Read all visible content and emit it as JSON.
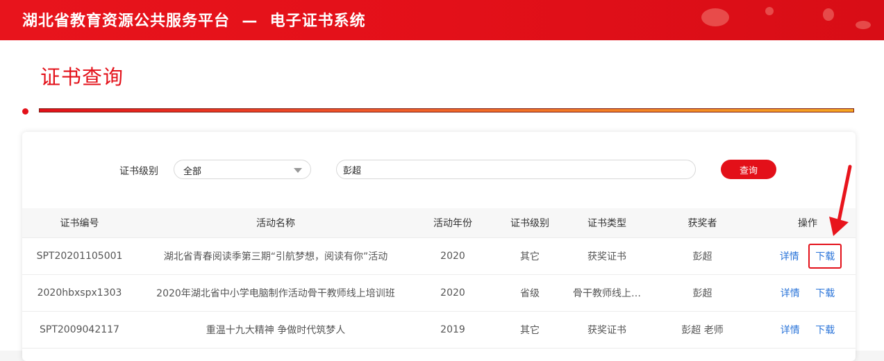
{
  "header": {
    "title": "湖北省教育资源公共服务平台  —  电子证书系统"
  },
  "page": {
    "title": "证书查询"
  },
  "filter": {
    "level_label": "证书级别",
    "level_selected": "全部",
    "search_value": "彭超",
    "search_button": "查询"
  },
  "table": {
    "headers": [
      "证书编号",
      "活动名称",
      "活动年份",
      "证书级别",
      "证书类型",
      "获奖者",
      "操作"
    ],
    "rows": [
      {
        "id": "SPT20201105001",
        "activity": "湖北省青春阅读季第三期“引航梦想，阅读有你”活动",
        "year": "2020",
        "level": "其它",
        "type": "获奖证书",
        "winner": "彭超",
        "detail": "详情",
        "download": "下载"
      },
      {
        "id": "2020hbxspx1303",
        "activity": "2020年湖北省中小学电脑制作活动骨干教师线上培训班",
        "year": "2020",
        "level": "省级",
        "type": "骨干教师线上…",
        "winner": "彭超",
        "detail": "详情",
        "download": "下载"
      },
      {
        "id": "SPT2009042117",
        "activity": "重温十九大精神 争做时代筑梦人",
        "year": "2019",
        "level": "其它",
        "type": "获奖证书",
        "winner": "彭超 老师",
        "detail": "详情",
        "download": "下载"
      }
    ]
  },
  "colors": {
    "brand_red": "#e31019",
    "link_blue": "#2a74d9",
    "annotation_red": "#e8141c"
  },
  "icons": {
    "select_caret": "chevron-down-icon",
    "annotation": "arrow-down-icon"
  }
}
